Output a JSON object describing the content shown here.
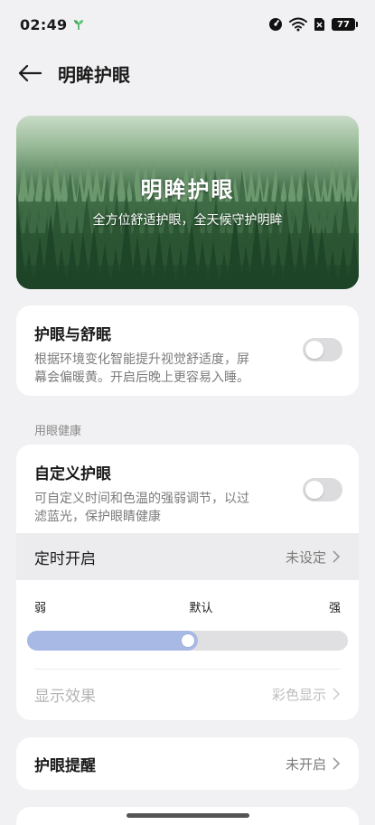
{
  "status_bar": {
    "time": "02:49",
    "battery": "77"
  },
  "header": {
    "title": "明眸护眼"
  },
  "banner": {
    "title": "明眸护眼",
    "subtitle": "全方位舒适护眼，全天候守护明眸"
  },
  "eye_sleep": {
    "title": "护眼与舒眠",
    "desc_line1": "根据环境变化智能提升视觉舒适度，屏",
    "desc_line2": "幕会偏暖黄。开启后晚上更容易入睡。",
    "enabled": false
  },
  "section": {
    "label": "用眼健康"
  },
  "custom_eye": {
    "title": "自定义护眼",
    "desc_line1": "可自定义时间和色温的强弱调节，以过",
    "desc_line2": "滤蓝光，保护眼睛健康",
    "enabled": false,
    "schedule_label": "定时开启",
    "schedule_value": "未设定",
    "slider_min": "弱",
    "slider_mid": "默认",
    "slider_max": "强",
    "slider_level": 0.5,
    "display_label": "显示效果",
    "display_value": "彩色显示"
  },
  "reminder": {
    "label": "护眼提醒",
    "value": "未开启"
  },
  "colors": {
    "accent_slider": "#a9b9e6",
    "toggle_off": "#dcdcde",
    "background": "#f1f1f3"
  },
  "icons": {
    "back": "back-arrow-icon",
    "chevron": "chevron-right-icon"
  }
}
